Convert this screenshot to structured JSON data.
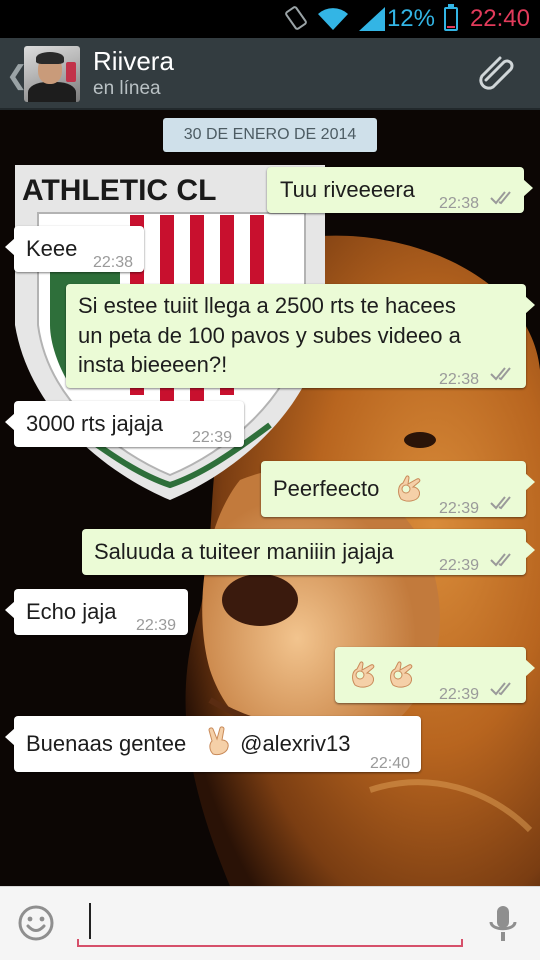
{
  "status_bar": {
    "battery_percent": "12%",
    "time": "22:40",
    "icons": [
      "rotation-lock-icon",
      "wifi-icon",
      "signal-icon",
      "battery-icon"
    ],
    "battery_level": 0.12
  },
  "header": {
    "contact_name": "Riivera",
    "contact_status": "en línea",
    "icons": [
      "back-chevron-icon",
      "avatar",
      "paperclip-icon"
    ]
  },
  "chat": {
    "date_label": "30 DE ENERO DE 2014",
    "messages": [
      {
        "direction": "out",
        "text": "Tuu riveeeera",
        "time": "22:38"
      },
      {
        "direction": "in",
        "text": "Keee",
        "time": "22:38"
      },
      {
        "direction": "out",
        "text_lines": [
          "Si estee tuiit llega a 2500 rts te hacees",
          "un peta de 100 pavos y subes videeo a",
          "insta bieeeen?!"
        ],
        "time": "22:38"
      },
      {
        "direction": "in",
        "text": "3000 rts jajaja",
        "time": "22:39"
      },
      {
        "direction": "out",
        "text": "Peerfeecto",
        "emoji": "ok-hand-emoji",
        "time": "22:39"
      },
      {
        "direction": "out",
        "text": "Saluuda a tuiteer maniiin jajaja",
        "time": "22:39"
      },
      {
        "direction": "in",
        "text": "Echo jaja",
        "time": "22:39"
      },
      {
        "direction": "out",
        "text": "",
        "emoji": "ok-hand-emoji x2",
        "time": "22:39"
      },
      {
        "direction": "in",
        "text_before": "Buenaas gentee",
        "emoji": "victory-hand-emoji",
        "text_after": " @alexriv13",
        "time": "22:40"
      }
    ]
  },
  "wallpaper": {
    "shield_text": "ATHLETIC CL"
  },
  "input_bar": {
    "placeholder": "",
    "icons": [
      "smiley-icon",
      "microphone-icon"
    ]
  },
  "colors": {
    "header_bg": "#333c40",
    "outgoing_bubble": "#ebfbd6",
    "incoming_bubble": "#ffffff",
    "date_chip": "#cfe0ea",
    "status_accent": "#33b5e5",
    "time_red": "#e23b5b",
    "input_underline": "#d6506a"
  }
}
